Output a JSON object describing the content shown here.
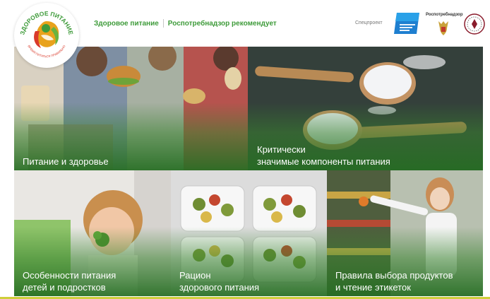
{
  "brand": {
    "logo_title": "ЗДОРОВОЕ ПИТАНИЕ",
    "logo_slogan": "ВРЕМЯ ПИТАТЬСЯ ПРАВИЛЬНО"
  },
  "nav": {
    "items": [
      {
        "label": "Здоровое питание"
      },
      {
        "label": "Роспотребнадзор рекомендует"
      }
    ]
  },
  "header": {
    "special_project": "Спецпроект",
    "partner_rpn": "Роспотребнадзор"
  },
  "tiles": [
    {
      "line1": "Питание и здоровье",
      "line2": ""
    },
    {
      "line1": "Критически",
      "line2": "значимые компоненты питания"
    },
    {
      "line1": "Особенности питания",
      "line2": "детей и подростков"
    },
    {
      "line1": "Рацион",
      "line2": "здорового питания"
    },
    {
      "line1": "Правила выбора продуктов",
      "line2": "и чтение этикеток"
    }
  ],
  "colors": {
    "nav_green": "#3e9b3a",
    "overlay_green": "#2f7d2c",
    "bottom_line": "#cfcf3a"
  }
}
